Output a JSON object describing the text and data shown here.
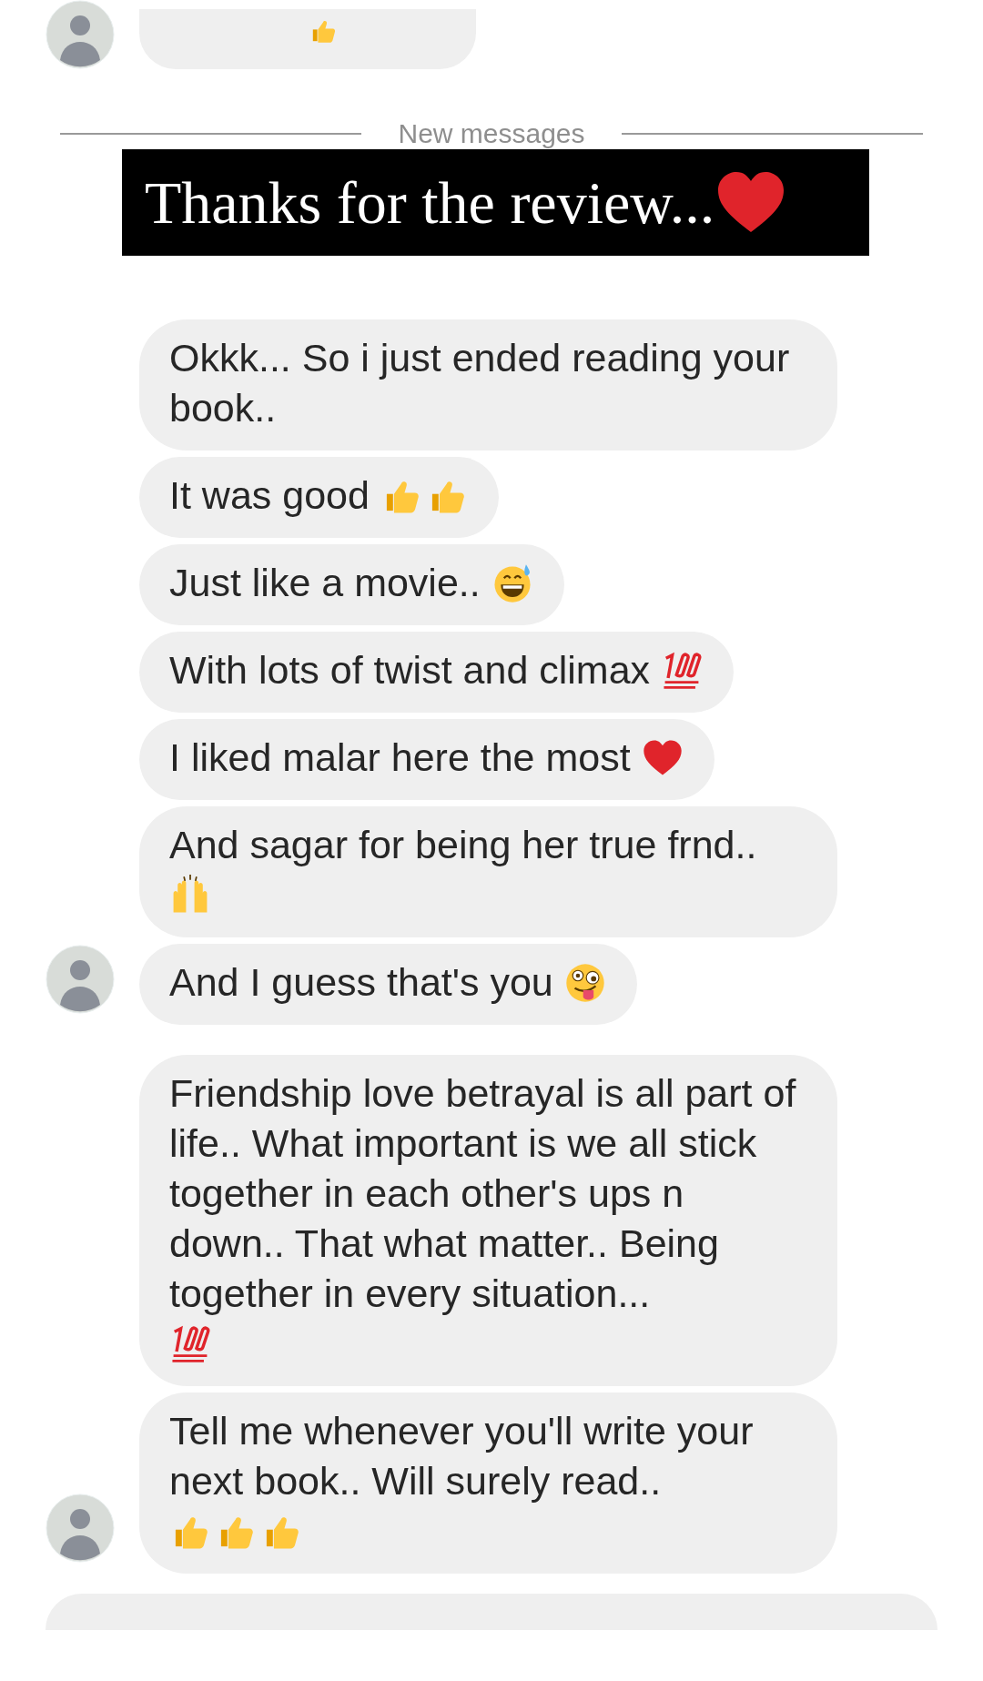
{
  "previous_message": {
    "avatar": true,
    "emoji": [
      {
        "kind": "thumbs-up"
      }
    ]
  },
  "divider": {
    "label": "New messages"
  },
  "overlay_banner": {
    "text": "Thanks for the review...",
    "emoji": [
      {
        "kind": "heart"
      }
    ]
  },
  "messages": [
    {
      "text": "Okkk... So i just ended reading your book..",
      "avatar": false
    },
    {
      "text": "It was good",
      "emoji": [
        {
          "kind": "thumbs-up"
        },
        {
          "kind": "thumbs-up"
        }
      ],
      "avatar": false
    },
    {
      "text": "Just like a movie..",
      "emoji": [
        {
          "kind": "grin-sweat"
        }
      ],
      "avatar": false
    },
    {
      "text": "With lots of twist and climax",
      "emoji": [
        {
          "kind": "hundred"
        }
      ],
      "avatar": false
    },
    {
      "text": "I liked malar here the most",
      "emoji": [
        {
          "kind": "heart"
        }
      ],
      "avatar": false
    },
    {
      "text": "And sagar for being her true frnd..",
      "emoji": [
        {
          "kind": "raised-hands"
        }
      ],
      "avatar": false
    },
    {
      "text": "And I guess that's you",
      "emoji": [
        {
          "kind": "zany"
        }
      ],
      "avatar": true
    },
    {
      "text": "Friendship love betrayal is all part of life.. What important is we all stick together in each other's ups n down.. That what matter.. Being together in every situation...",
      "emoji": [
        {
          "kind": "hundred"
        }
      ],
      "avatar": false
    },
    {
      "text": "Tell me whenever you'll write your next book.. Will surely read..",
      "emoji": [
        {
          "kind": "thumbs-up"
        },
        {
          "kind": "thumbs-up"
        },
        {
          "kind": "thumbs-up"
        }
      ],
      "avatar": true
    }
  ]
}
